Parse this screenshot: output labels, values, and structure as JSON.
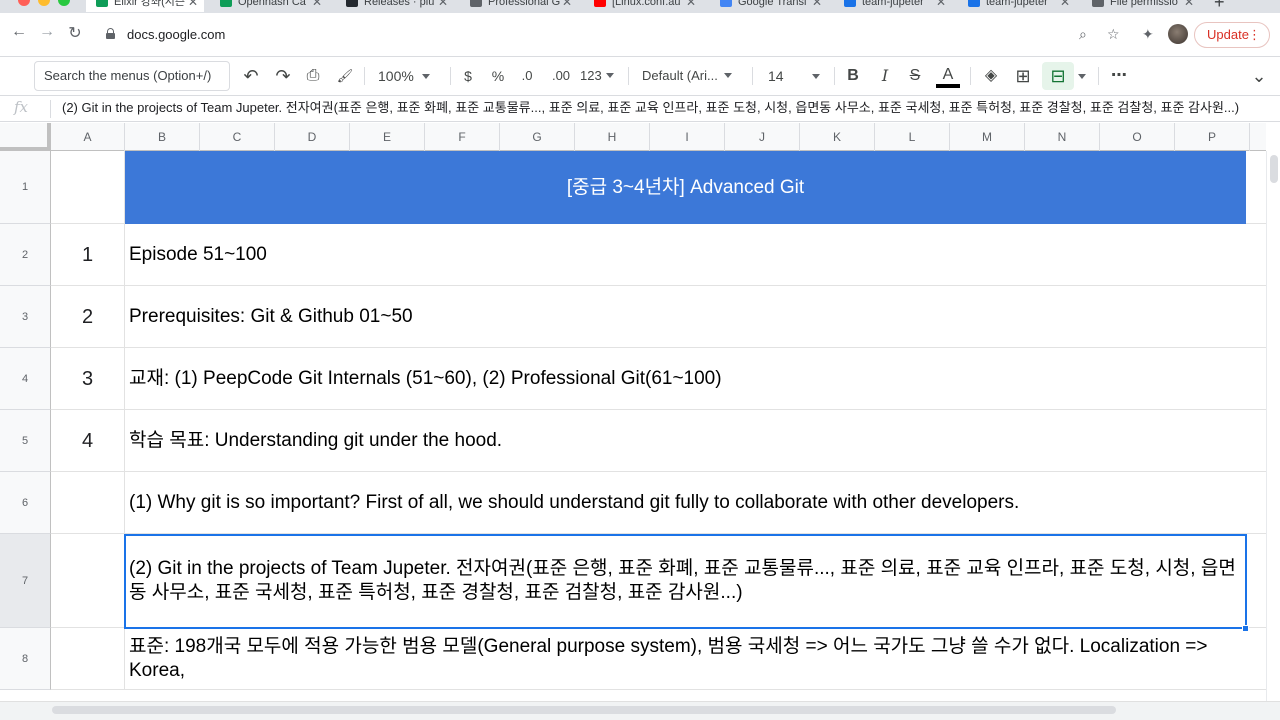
{
  "browser": {
    "tabs": [
      {
        "label": "Elixir 강좌(시즌",
        "icon": "sheets-icon",
        "color": "#0f9d58",
        "active": true
      },
      {
        "label": "Openhash Ca",
        "icon": "sheets-icon",
        "color": "#0f9d58"
      },
      {
        "label": "Releases · plu",
        "icon": "github-icon",
        "color": "#24292f"
      },
      {
        "label": "Professional G",
        "icon": "chrome-icon",
        "color": "#5f6368"
      },
      {
        "label": "[Linux.conf.au",
        "icon": "youtube-icon",
        "color": "#ff0000"
      },
      {
        "label": "Google Transl",
        "icon": "translate-icon",
        "color": "#4285f4"
      },
      {
        "label": "team-jupeter",
        "icon": "doc-icon",
        "color": "#1a73e8"
      },
      {
        "label": "team-jupeter",
        "icon": "doc-icon",
        "color": "#1a73e8"
      },
      {
        "label": "File permissio",
        "icon": "doc-icon",
        "color": "#5f6368"
      }
    ],
    "new_tab_symbol": "+",
    "close_symbol": "✕",
    "url": "docs.google.com",
    "update_label": "Update",
    "update_more": "⋮",
    "back": "←",
    "forward": "→",
    "reload": "↻",
    "zoom_icon_glyph": "⌕",
    "star_glyph": "☆",
    "extensions_glyph": "✦"
  },
  "toolbar": {
    "menu_search_placeholder": "Search the menus (Option+/)",
    "undo": "↶",
    "redo": "↷",
    "print": "⎙",
    "paint_format": "🖌",
    "zoom": "100%",
    "currency": "$",
    "percent": "%",
    "decrease_decimal": ".0",
    "increase_decimal": ".00",
    "more_formats": "123",
    "font": "Default (Ari...",
    "font_size": "14",
    "bold": "B",
    "italic": "I",
    "strikethrough": "S",
    "text_color": "A",
    "fill_color": "◈",
    "borders": "⊞",
    "merge": "⊟",
    "more": "⋯",
    "collapse": "⌄"
  },
  "formula_bar": {
    "fx": "fx",
    "content": "(2) Git in the projects of Team Jupeter. 전자여권(표준 은행, 표준 화폐, 표준 교통물류..., 표준 의료, 표준 교육 인프라, 표준 도청, 시청, 읍면동 사무소, 표준 국세청, 표준 특허청, 표준 경찰청, 표준 검찰청, 표준 감사원...)"
  },
  "columns": [
    "A",
    "B",
    "C",
    "D",
    "E",
    "F",
    "G",
    "H",
    "I",
    "J",
    "K",
    "L",
    "M",
    "N",
    "O",
    "P"
  ],
  "rows": [
    {
      "num": "1",
      "a": "",
      "b": "[중급 3~4년차] Advanced Git"
    },
    {
      "num": "2",
      "a": "1",
      "b": "Episode 51~100"
    },
    {
      "num": "3",
      "a": "2",
      "b": "Prerequisites: Git & Github 01~50"
    },
    {
      "num": "4",
      "a": "3",
      "b": "교재: (1) PeepCode Git Internals (51~60), (2) Professional Git(61~100)"
    },
    {
      "num": "5",
      "a": "4",
      "b": "학습 목표: Understanding git under the hood."
    },
    {
      "num": "6",
      "a": "",
      "b": "(1) Why git is so important? First of all, we should understand git fully to collaborate with other developers."
    },
    {
      "num": "7",
      "a": "",
      "b": "(2) Git in the projects of Team Jupeter. 전자여권(표준 은행, 표준 화폐, 표준 교통물류..., 표준 의료, 표준 교육 인프라, 표준 도청, 시청, 읍면동 사무소, 표준 국세청, 표준 특허청, 표준 경찰청, 표준 검찰청, 표준 감사원...)"
    },
    {
      "num": "8",
      "a": "",
      "b": "표준: 198개국 모두에 적용 가능한 범용 모델(General purpose system), 범용 국세청 => 어느 국가도 그냥 쓸 수가 없다. Localization => Korea,"
    }
  ],
  "colors": {
    "header_fill": "#3c78d8",
    "selection": "#1a73e8",
    "sheets_green": "#0f9d58"
  }
}
